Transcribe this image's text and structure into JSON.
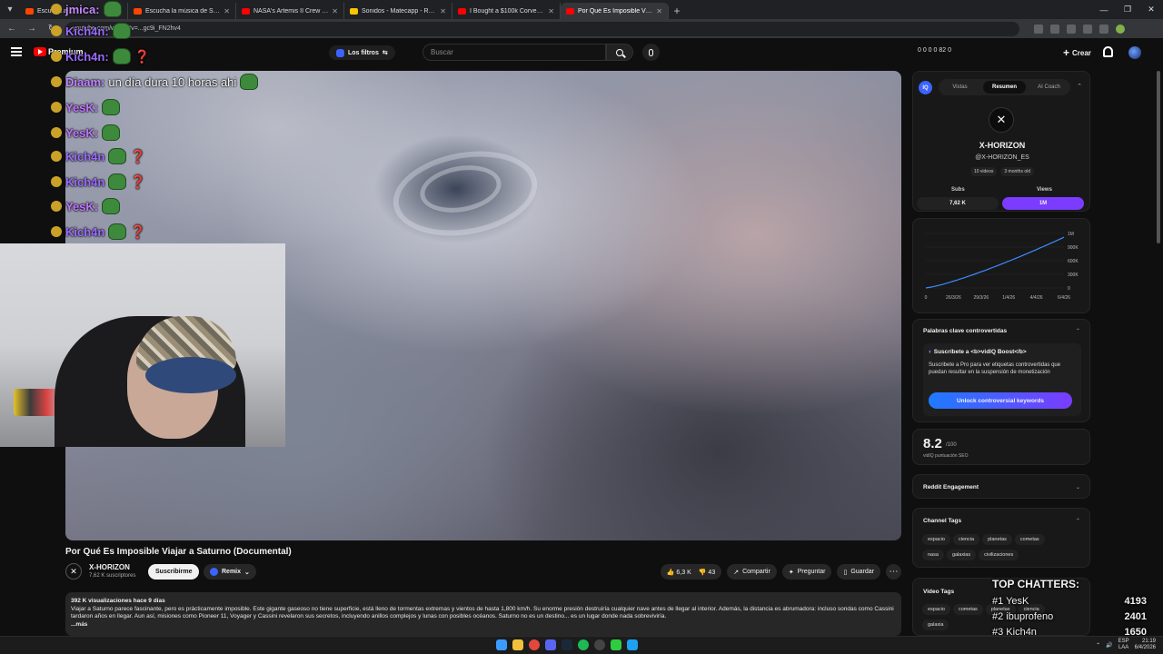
{
  "browser": {
    "tabs": [
      {
        "label": "Escucha a ...",
        "color": "#ff4500"
      },
      {
        "label": "Escucha la música de Slimepay",
        "color": "#ff4500"
      },
      {
        "label": "NASA's Artemis II Crew Flies Ar",
        "color": "#ff0000"
      },
      {
        "label": "Sonidos - Matecapp - Ranking",
        "color": "#f7c600"
      },
      {
        "label": "I Bought a $100k Corvette Z06",
        "color": "#ff0000"
      },
      {
        "label": "Por Qué Es Imposible Viaje",
        "color": "#ff0000"
      }
    ],
    "close_glyph": "✕",
    "new_tab_glyph": "+",
    "url": "youtube.com/watch?v=...gc9i_FN2hv4"
  },
  "header": {
    "brand": "Premium",
    "filters_label": "Los filtros",
    "search_placeholder": "Buscar",
    "stats": "0 0 0 0 82 0",
    "create_label": "Crear",
    "accent": "#ff0000"
  },
  "chat": [
    {
      "user": "jmica:",
      "msg": "",
      "color": "#c58aff",
      "emote": true,
      "q": false
    },
    {
      "user": "Kich4n:",
      "msg": "",
      "color": "#9b6bff",
      "emote": true,
      "q": false
    },
    {
      "user": "Kich4n:",
      "msg": "",
      "color": "#9b6bff",
      "emote": true,
      "q": true
    },
    {
      "user": "Diaam:",
      "msg": "un día dura 10 horas ahi",
      "color": "#c084ff",
      "emote": true,
      "q": false
    },
    {
      "user": "YesK:",
      "msg": "",
      "color": "#c074ff",
      "emote": true,
      "q": false
    },
    {
      "user": "YesK:",
      "msg": "",
      "color": "#c074ff",
      "emote": true,
      "q": false
    },
    {
      "user": "Kich4n",
      "msg": "",
      "color": "#9b6bff",
      "emote": true,
      "q": true
    },
    {
      "user": "Kich4n",
      "msg": "",
      "color": "#9b6bff",
      "emote": true,
      "q": true
    },
    {
      "user": "YesK:",
      "msg": "",
      "color": "#c074ff",
      "emote": true,
      "q": false
    },
    {
      "user": "Kich4n",
      "msg": "",
      "color": "#9b6bff",
      "emote": true,
      "q": true
    }
  ],
  "video": {
    "title": "Por Qué Es Imposible Viajar a Saturno (Documental)",
    "channel": "X-HORIZON",
    "subscribers": "7,62 K suscriptores",
    "subscribe_label": "Suscribirme",
    "remix_label": "Remix",
    "likes": "6,3 K",
    "dislikes": "43",
    "share_label": "Compartir",
    "ask_label": "Preguntar",
    "save_label": "Guardar",
    "stats": "392 K visualizaciones  hace 9 días",
    "description": "Viajar a Saturno parece fascinante, pero es prácticamente imposible. Este gigante gaseoso no tiene superficie, está lleno de tormentas extremas y vientos de hasta 1,800 km/h. Su enorme presión destruiría cualquier nave antes de llegar al interior. Además, la distancia es abrumadora: incluso sondas como Cassini tardaron años en llegar. Aun así, misiones como Pioneer 11, Voyager y Cassini revelaron sus secretos, incluyendo anillos complejos y lunas con posibles océanos. Saturno no es un destino... es un lugar donde nada sobreviviría.",
    "more_label": "...más"
  },
  "vidiq": {
    "tabs": [
      "Vistas",
      "Resumen",
      "AI Coach"
    ],
    "channel_name": "X-HORIZON",
    "handle": "@X-HORIZON_ES",
    "pill_videos": "10 videos",
    "pill_age": "3 months old",
    "subs_label": "Subs",
    "subs_value": "7,62 K",
    "views_label": "Views",
    "views_value": "1M",
    "views_color": "#7b3cff",
    "chart_y_ticks": [
      "1M",
      "900K",
      "600K",
      "300K",
      "0"
    ],
    "chart_x_ticks": [
      "0",
      "26/3/26",
      "29/3/26",
      "1/4/26",
      "4/4/26",
      "6/4/26"
    ],
    "keywords_title": "Palabras clave controvertidas",
    "boost_title": "Suscríbete a <b>vidIQ Boost</b>",
    "boost_desc": "Suscribete a Pro para ver etiquetas controvertidas que puedan resultar en la suspensión de monetización",
    "unlock_label": "Unlock controversial keywords",
    "seo_score": "8.2",
    "seo_of": "/100",
    "seo_label": "vidIQ puntuación SEO",
    "reddit_label": "Reddit Engagement",
    "channel_tags_label": "Channel Tags",
    "channel_tags": [
      "espacio",
      "ciencia",
      "planetas",
      "cometas",
      "nasa",
      "galaxias",
      "civilizaciones"
    ],
    "video_tags_label": "Video Tags",
    "video_tags": [
      "espacio",
      "cometas",
      "planetas",
      "ciencia",
      "galaxia"
    ]
  },
  "top_chatters": {
    "title": "TOP CHATTERS:",
    "rows": [
      {
        "name": "#1 YesK",
        "count": "4193"
      },
      {
        "name": "#2 ibuprofeno",
        "count": "2401"
      },
      {
        "name": "#3 Kich4n",
        "count": "1650"
      }
    ]
  },
  "taskbar": {
    "lang": "ESP",
    "lang2": "LAA",
    "time": "21:19",
    "date": "6/4/2026"
  }
}
